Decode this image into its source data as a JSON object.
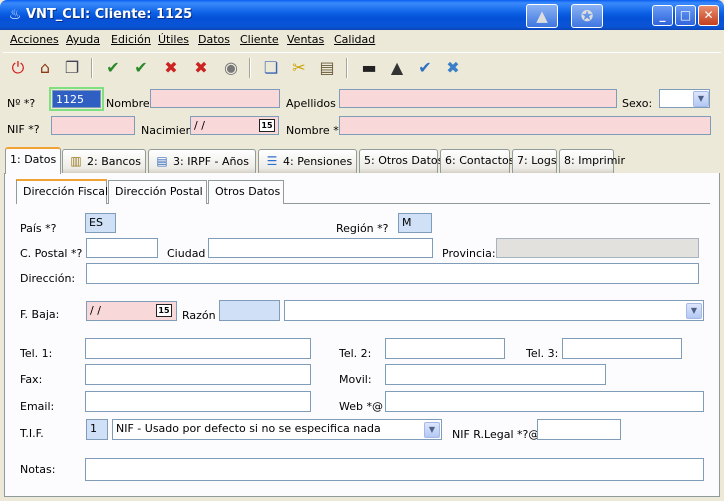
{
  "window": {
    "title": "VNT_CLI: Cliente: 1125"
  },
  "menu": [
    "Acciones",
    "Ayuda",
    "Edición",
    "Útiles",
    "Datos",
    "Cliente",
    "Ventas",
    "Calidad"
  ],
  "header": {
    "num_label": "Nº *?",
    "num_value": "1125",
    "nombre_label": "Nombre",
    "apellidos_label": "Apellidos",
    "sexo_label": "Sexo:",
    "nif_label": "NIF *?",
    "nacimiento_label": "Nacimien.",
    "nacimiento_value": "/ /",
    "nombre2_label": "Nombre *?"
  },
  "tabs": [
    {
      "label": "1: Datos"
    },
    {
      "label": "2: Bancos"
    },
    {
      "label": "3: IRPF - Años"
    },
    {
      "label": "4: Pensiones"
    },
    {
      "label": "5: Otros Datos"
    },
    {
      "label": "6: Contactos"
    },
    {
      "label": "7: Logs"
    },
    {
      "label": "8: Imprimir"
    }
  ],
  "subtabs": [
    "Dirección Fiscal",
    "Dirección Postal",
    "Otros Datos"
  ],
  "fiscal": {
    "pais_label": "País *?",
    "pais_value": "ES",
    "region_label": "Región *?",
    "region_value": "M",
    "cpostal_label": "C. Postal *?",
    "ciudad_label": "Ciudad",
    "provincia_label": "Provincia:",
    "direccion_label": "Dirección:",
    "fbaja_label": "F. Baja:",
    "fbaja_value": "/ /",
    "razon_label": "Razón",
    "tel1_label": "Tel. 1:",
    "tel2_label": "Tel. 2:",
    "tel3_label": "Tel. 3:",
    "fax_label": "Fax:",
    "movil_label": "Movil:",
    "email_label": "Email:",
    "web_label": "Web *@",
    "tif_label": "T.I.F.",
    "tif_code": "1",
    "tif_option": "NIF - Usado por defecto si no se especifica nada",
    "nif_legal_label": "NIF R.Legal *?@",
    "notas_label": "Notas:"
  },
  "calendar_glyph": "15"
}
